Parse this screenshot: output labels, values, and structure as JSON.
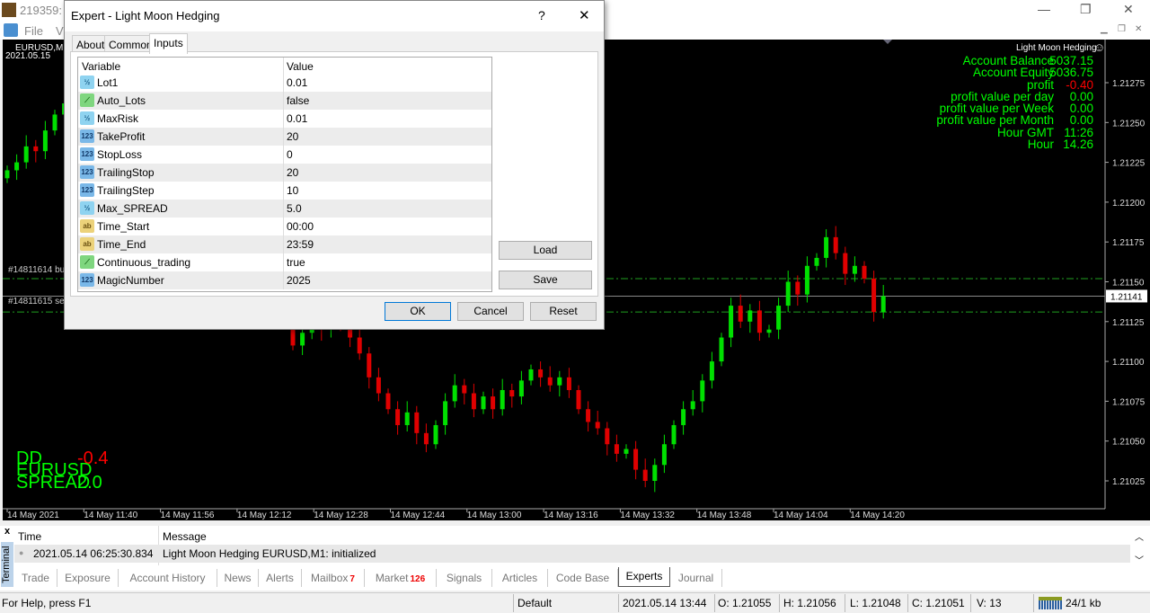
{
  "window": {
    "title": "219359: F",
    "menu_file": "File",
    "menu_view": "Vi"
  },
  "chart": {
    "symbol": "EURUSD,M1",
    "date": "2021.05.15",
    "ea_name": "Light Moon Hedging",
    "info": [
      {
        "label": "Account Balance",
        "value": "5037.15"
      },
      {
        "label": "Account Equity",
        "value": "5036.75"
      },
      {
        "label": "profit",
        "value": "-0.40",
        "negative": true
      },
      {
        "label": "profit value per day",
        "value": "0.00"
      },
      {
        "label": "profit value per Week",
        "value": "0.00"
      },
      {
        "label": "profit value per Month",
        "value": "0.00"
      },
      {
        "label": "Hour GMT",
        "value": "11:26"
      },
      {
        "label": "Hour",
        "value": "14.26"
      }
    ],
    "dd_label": "DD",
    "dd_value": "-0.4",
    "symbol_label": "EURUSD",
    "spread_label": "SPREAD",
    "spread_value": "2.0",
    "order_buy": "#14811614 bu",
    "order_sell": "#14811615 se",
    "current_price": "1.21141",
    "colors": {
      "bull": "#00e000",
      "bear": "#e00000",
      "text": "#00ff00",
      "negative": "#ff0000"
    }
  },
  "chart_data": {
    "type": "candlestick",
    "symbol": "EURUSD",
    "timeframe": "M1",
    "price_ticks": [
      "1.21275",
      "1.21250",
      "1.21225",
      "1.21200",
      "1.21175",
      "1.21150",
      "1.21125",
      "1.21100",
      "1.21075",
      "1.21050",
      "1.21025"
    ],
    "time_ticks": [
      "14 May 2021",
      "14 May 11:40",
      "14 May 11:56",
      "14 May 12:12",
      "14 May 12:28",
      "14 May 12:44",
      "14 May 13:00",
      "14 May 13:16",
      "14 May 13:32",
      "14 May 13:48",
      "14 May 14:04",
      "14 May 14:20"
    ],
    "ylim": [
      1.2101,
      1.2129
    ],
    "closes": [
      1.2122,
      1.21225,
      1.21235,
      1.21232,
      1.21245,
      1.21255,
      1.21262,
      1.21265,
      1.21258,
      1.2125,
      1.21245,
      1.21238,
      1.2123,
      1.21222,
      1.21215,
      1.21208,
      1.212,
      1.21195,
      1.21188,
      1.2118,
      1.21175,
      1.2117,
      1.21165,
      1.2116,
      1.21155,
      1.2115,
      1.21145,
      1.2114,
      1.21135,
      1.21128,
      1.2111,
      1.21118,
      1.21125,
      1.2112,
      1.2113,
      1.21122,
      1.21115,
      1.21105,
      1.2109,
      1.2108,
      1.2107,
      1.2106,
      1.21068,
      1.21055,
      1.21048,
      1.2106,
      1.21075,
      1.21085,
      1.2108,
      1.2107,
      1.21078,
      1.2107,
      1.21082,
      1.21078,
      1.21088,
      1.21095,
      1.2109,
      1.21085,
      1.2109,
      1.21082,
      1.2107,
      1.21062,
      1.21058,
      1.21048,
      1.21042,
      1.21045,
      1.21032,
      1.21025,
      1.21035,
      1.21048,
      1.2106,
      1.2107,
      1.21075,
      1.21088,
      1.211,
      1.21115,
      1.21135,
      1.21125,
      1.21132,
      1.21118,
      1.2112,
      1.21135,
      1.2115,
      1.21142,
      1.2116,
      1.21165,
      1.21178,
      1.21168,
      1.21155,
      1.2116,
      1.21152,
      1.21131,
      1.21141
    ],
    "levels": [
      {
        "price": 1.21152,
        "style": "dash-dot",
        "color": "#1f9f1f"
      },
      {
        "price": 1.21131,
        "style": "dash-dot",
        "color": "#1f9f1f"
      },
      {
        "price": 1.21141,
        "style": "solid",
        "color": "#888888"
      }
    ]
  },
  "dialog": {
    "title": "Expert - Light Moon Hedging",
    "help": "?",
    "close": "✕",
    "tabs": [
      "About",
      "Common",
      "Inputs"
    ],
    "col_variable": "Variable",
    "col_value": "Value",
    "inputs": [
      {
        "name": "Lot1",
        "value": "0.01",
        "type": "double",
        "icon": "½"
      },
      {
        "name": "Auto_Lots",
        "value": "false",
        "type": "bool",
        "icon": "⟋"
      },
      {
        "name": "MaxRisk",
        "value": "0.01",
        "type": "double",
        "icon": "½"
      },
      {
        "name": "TakeProfit",
        "value": "20",
        "type": "int",
        "icon": "123"
      },
      {
        "name": "StopLoss",
        "value": "0",
        "type": "int",
        "icon": "123"
      },
      {
        "name": "TrailingStop",
        "value": "20",
        "type": "int",
        "icon": "123"
      },
      {
        "name": "TrailingStep",
        "value": "10",
        "type": "int",
        "icon": "123"
      },
      {
        "name": "Max_SPREAD",
        "value": "5.0",
        "type": "double",
        "icon": "½"
      },
      {
        "name": "Time_Start",
        "value": "00:00",
        "type": "string",
        "icon": "ab"
      },
      {
        "name": "Time_End",
        "value": "23:59",
        "type": "string",
        "icon": "ab"
      },
      {
        "name": "Continuous_trading",
        "value": "true",
        "type": "bool",
        "icon": "⟋"
      },
      {
        "name": "MagicNumber",
        "value": "2025",
        "type": "int",
        "icon": "123"
      }
    ],
    "load": "Load",
    "save": "Save",
    "ok": "OK",
    "cancel": "Cancel",
    "reset": "Reset"
  },
  "terminal": {
    "side_label": "Terminal",
    "close": "x",
    "col_time": "Time",
    "col_message": "Message",
    "rows": [
      {
        "time": "2021.05.14 06:25:30.834",
        "message": "Light Moon Hedging EURUSD,M1: initialized"
      }
    ],
    "tabs": [
      {
        "label": "Trade"
      },
      {
        "label": "Exposure"
      },
      {
        "label": "Account History"
      },
      {
        "label": "News"
      },
      {
        "label": "Alerts"
      },
      {
        "label": "Mailbox",
        "badge": "7"
      },
      {
        "label": "Market",
        "badge": "126"
      },
      {
        "label": "Signals"
      },
      {
        "label": "Articles"
      },
      {
        "label": "Code Base"
      },
      {
        "label": "Experts",
        "active": true
      },
      {
        "label": "Journal"
      }
    ]
  },
  "status": {
    "help": "For Help, press F1",
    "profile": "Default",
    "datetime": "2021.05.14 13:44",
    "open": "O: 1.21055",
    "high": "H: 1.21056",
    "low": "L: 1.21048",
    "close": "C: 1.21051",
    "volume": "V: 13",
    "traffic": "24/1 kb"
  }
}
